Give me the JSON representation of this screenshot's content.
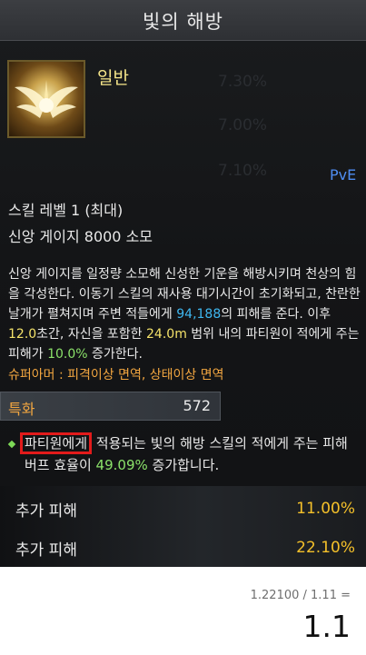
{
  "tooltip": {
    "title": "빛의 해방",
    "background_numbers": [
      "7.30%",
      "7.00%",
      "7.10%"
    ],
    "grade": "일반",
    "mode_tag": "PvE",
    "skill_level": "스킬 레벨 1 (최대)",
    "cost": "신앙 게이지 8000 소모",
    "description": {
      "p1": "신앙 게이지를 일정량 소모해 신성한 기운을 해방시키며 천상의 힘을 각성한다. 이동기 스킬의 재사용 대기시간이 초기화되고, 찬란한 날개가 펼쳐지며 주변 적들에게 ",
      "damage": "94,188",
      "p2": "의 피해를 준다. 이후 ",
      "duration": "12.0",
      "p3": "초간, 자신을 포함한 ",
      "range": "24.0m",
      "p4": " 범위 내의 파티원이 적에게 주는 피해가 ",
      "buff": "10.0%",
      "p5": " 증가한다."
    },
    "super_armor": "슈퍼아머 : 피격이상 면역, 상태이상 면역"
  },
  "specialization": {
    "label": "특화",
    "value": "572"
  },
  "effect": {
    "boxed_text": "파티원에게",
    "text1": " 적용되는 빛의 해방 스킬의 적에게 주는 피해 버프 효율이 ",
    "value": "49.09%",
    "text2": " 증가합니다."
  },
  "extra_damage": [
    {
      "label": "추가 피해",
      "value": "11.00%"
    },
    {
      "label": "추가 피해",
      "value": "22.10%"
    }
  ],
  "calc": {
    "formula": "1.22100 / 1.11 =",
    "result": "1.1"
  },
  "colors": {
    "accent_orange": "#f2a640",
    "value_yellow": "#f4c02a",
    "highlight_red": "#e21b1b",
    "blue": "#3fb7f0",
    "green": "#8be26a"
  }
}
